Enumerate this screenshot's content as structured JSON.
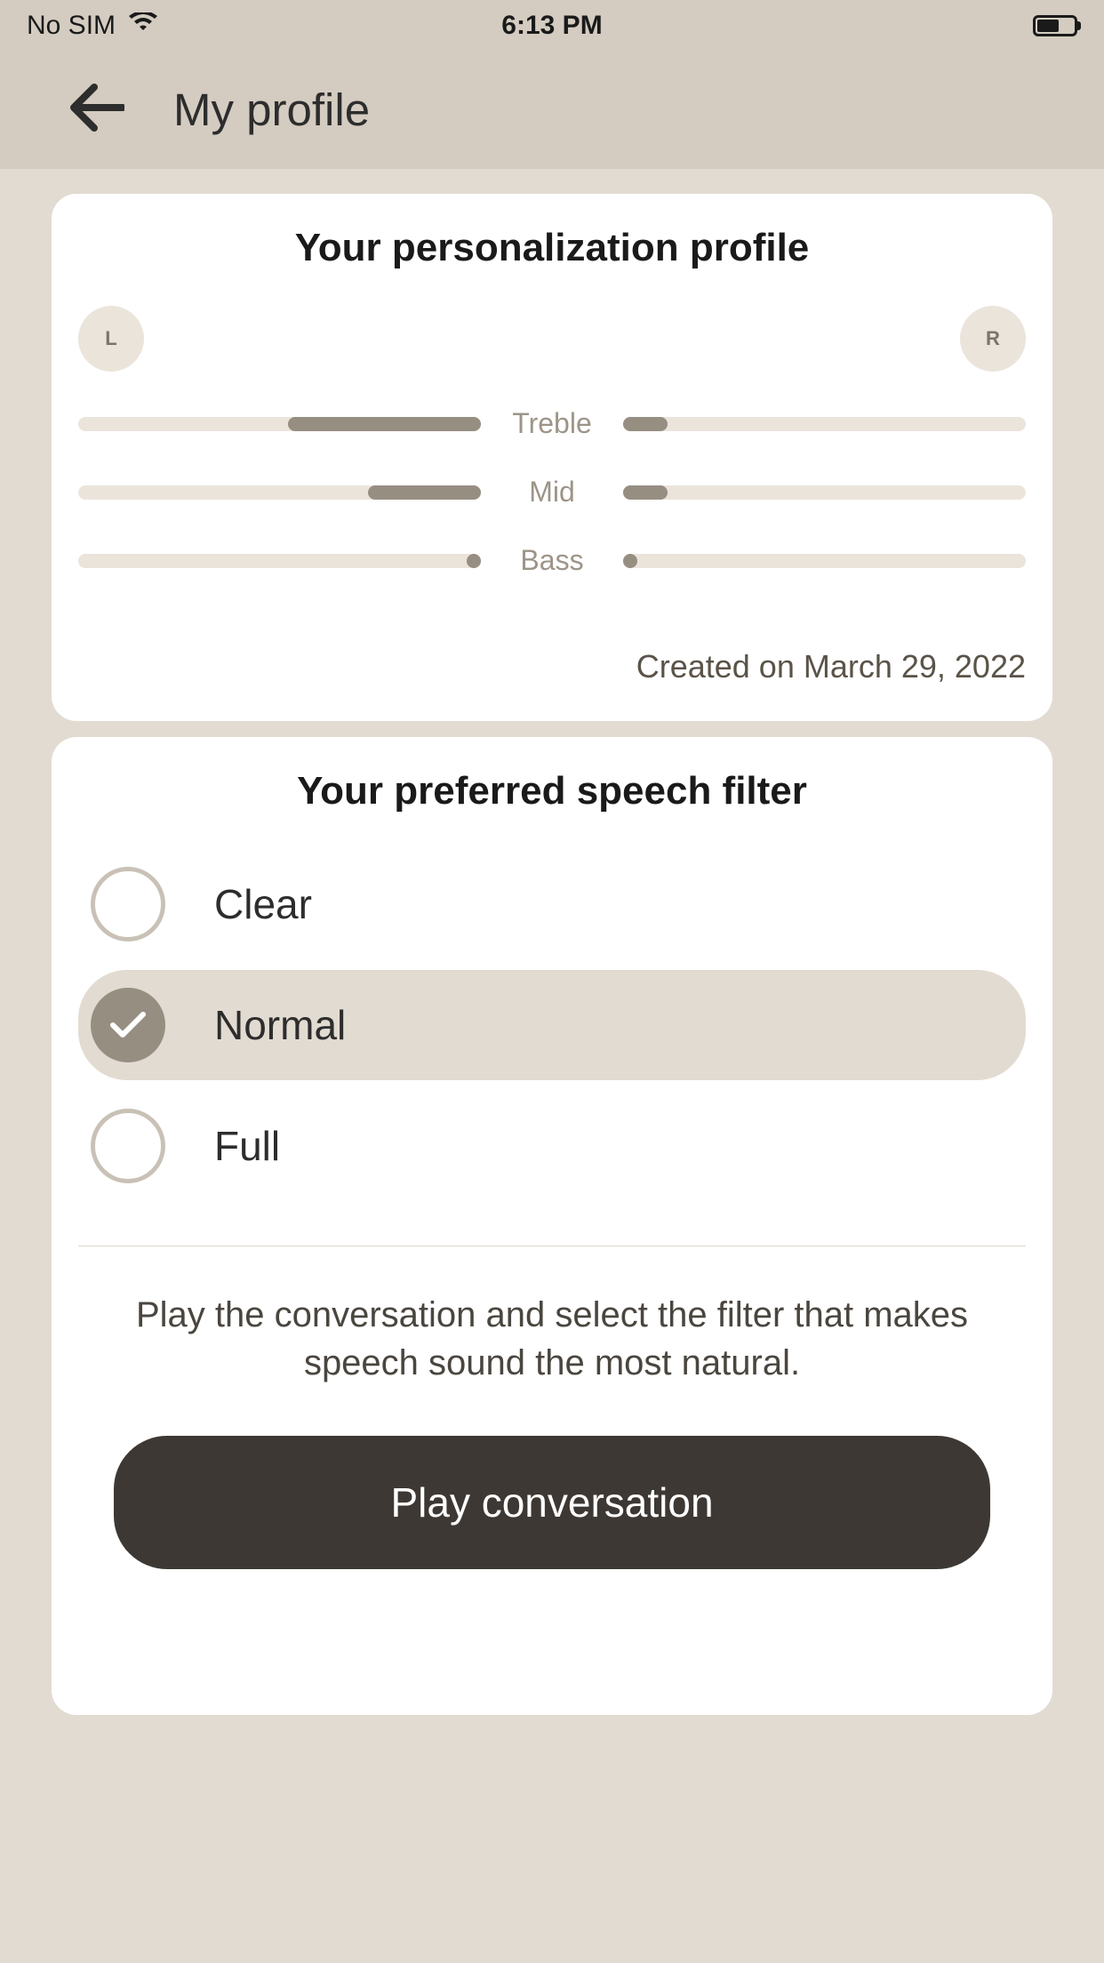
{
  "statusBar": {
    "carrier": "No SIM",
    "time": "6:13 PM"
  },
  "header": {
    "title": "My profile"
  },
  "profile": {
    "title": "Your personalization profile",
    "leftLabel": "L",
    "rightLabel": "R",
    "bands": {
      "treble": "Treble",
      "mid": "Mid",
      "bass": "Bass"
    },
    "levels": {
      "left": {
        "treble": 48,
        "mid": 28,
        "bass": 2
      },
      "right": {
        "treble": 11,
        "mid": 11,
        "bass": 2
      }
    },
    "createdText": "Created on March 29, 2022"
  },
  "filter": {
    "title": "Your preferred speech filter",
    "options": {
      "clear": "Clear",
      "normal": "Normal",
      "full": "Full"
    },
    "selected": "normal",
    "instruction": "Play the conversation and select the filter that makes speech sound the most natural.",
    "playButton": "Play conversation"
  }
}
